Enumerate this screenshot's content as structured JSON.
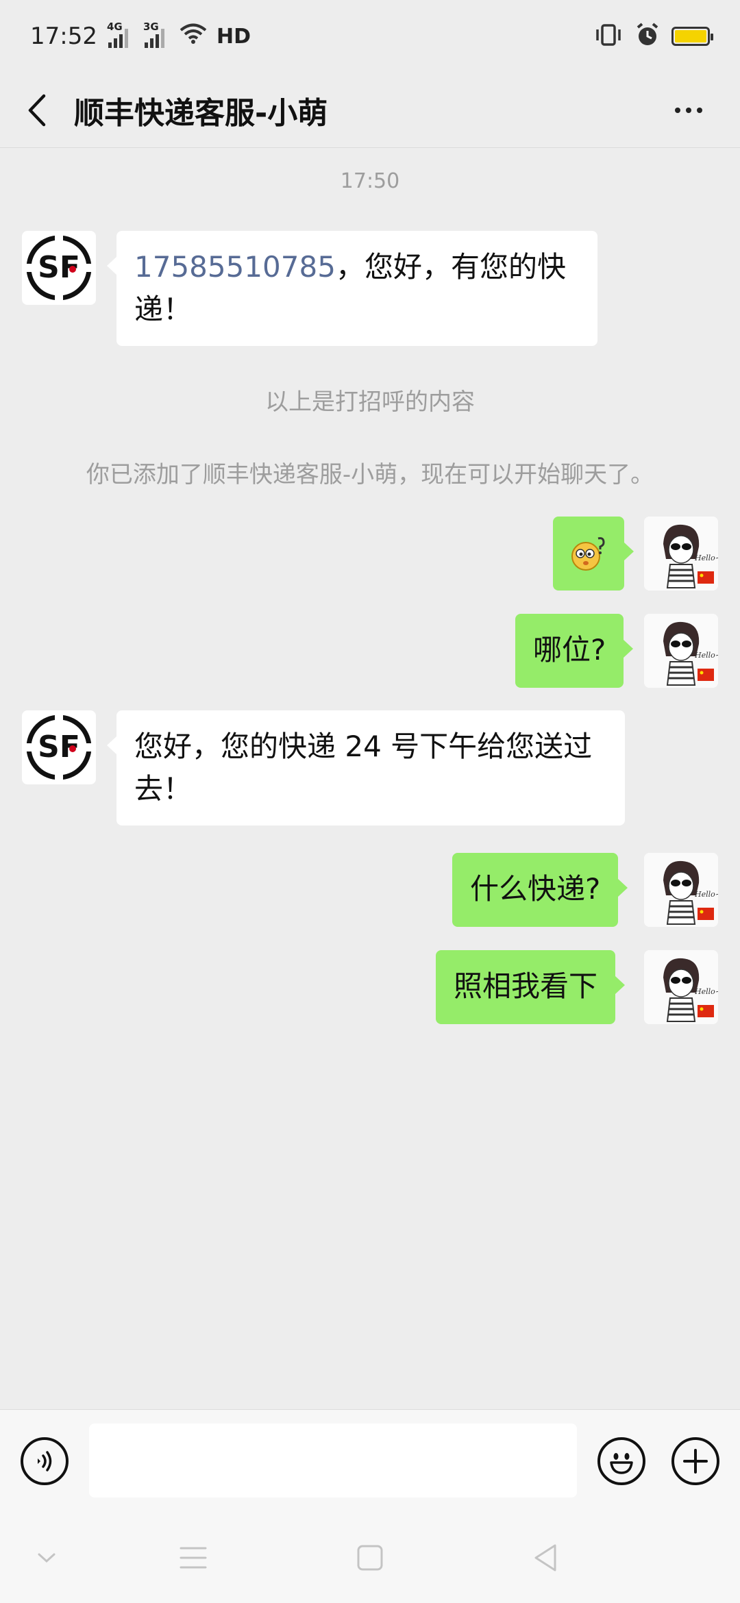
{
  "status_bar": {
    "time": "17:52",
    "signal1_label": "4G",
    "signal2_label": "3G",
    "network_label": "HD",
    "battery_color": "#f5d300"
  },
  "header": {
    "title": "顺丰快递客服-小萌"
  },
  "chat": {
    "timestamp": "17:50",
    "greeting_phone": "17585510785",
    "greeting_rest": "，您好，有您的快递！",
    "system_greeting_note": "以上是打招呼的内容",
    "system_added_note": "你已添加了顺丰快递客服-小萌，现在可以开始聊天了。",
    "msg_who": "哪位?",
    "msg_delivery": "您好，您的快递 24 号下午给您送过去！",
    "msg_what": "什么快递?",
    "msg_photo": "照相我看下",
    "sf_logo_text": "SF",
    "avatar_hello_text": "Hello~"
  },
  "input_bar": {
    "placeholder": ""
  },
  "colors": {
    "outgoing_bubble": "#95ec69",
    "incoming_bubble": "#ffffff",
    "link": "#576b95",
    "background": "#ededed"
  }
}
